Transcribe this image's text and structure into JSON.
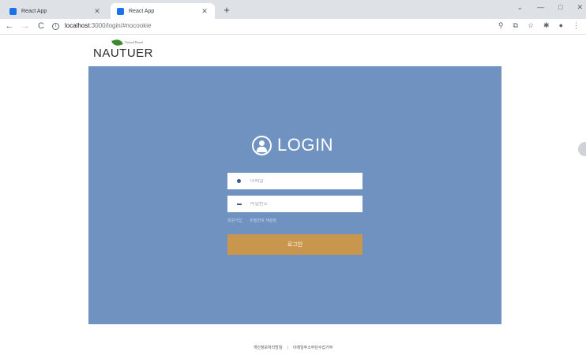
{
  "browser": {
    "tabs": [
      {
        "title": "React App",
        "active": false
      },
      {
        "title": "React App",
        "active": true
      }
    ],
    "new_tab": "+",
    "window_controls": {
      "minimize": "—",
      "maximize": "□",
      "close": "✕"
    },
    "nav": {
      "back": "←",
      "forward": "→",
      "reload": "C"
    },
    "url_host": "localhost",
    "url_path": ":3000/login/#nocookie",
    "toolbar_icons": [
      "search-icon",
      "share-icon",
      "star-icon",
      "extensions-icon",
      "profile-icon",
      "menu-icon"
    ]
  },
  "logo": {
    "small_text": "Natural Brand",
    "text": "NAUTUER"
  },
  "login": {
    "title": "LOGIN",
    "email_placeholder": "이메일",
    "password_placeholder": "비밀번호",
    "signup_link": "회원가입",
    "find_password_link": "비밀번호 재설정",
    "submit_label": "로그인",
    "panel_color": "#7092c0",
    "button_color": "#c8964c"
  },
  "footer": {
    "privacy": "개인정보처리방침",
    "separator": "|",
    "email_refusal": "이메일주소무단수집거부"
  }
}
